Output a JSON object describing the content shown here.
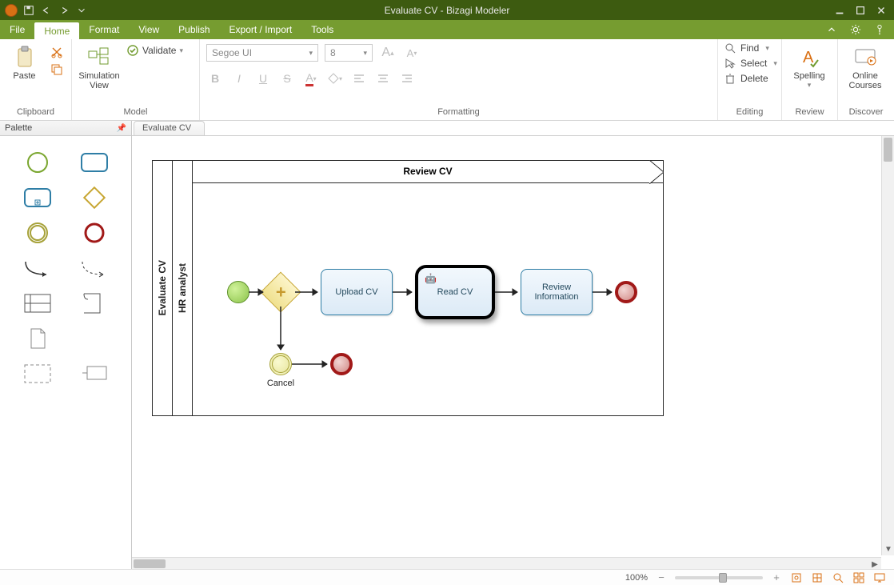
{
  "title": "Evaluate CV - Bizagi Modeler",
  "menu": {
    "file": "File",
    "home": "Home",
    "format": "Format",
    "view": "View",
    "publish": "Publish",
    "export": "Export / Import",
    "tools": "Tools"
  },
  "ribbon": {
    "clipboard": {
      "paste": "Paste",
      "caption": "Clipboard"
    },
    "model": {
      "sim1": "Simulation",
      "sim2": "View",
      "validate": "Validate",
      "caption": "Model"
    },
    "formatting": {
      "font": "Segoe UI",
      "size": "8",
      "caption": "Formatting"
    },
    "editing": {
      "find": "Find",
      "select": "Select",
      "delete": "Delete",
      "caption": "Editing"
    },
    "review": {
      "spelling": "Spelling",
      "caption": "Review"
    },
    "discover": {
      "courses1": "Online",
      "courses2": "Courses",
      "caption": "Discover"
    }
  },
  "palette": {
    "title": "Palette"
  },
  "tab": "Evaluate CV",
  "diagram": {
    "pool": "Evaluate CV",
    "lane": "HR analyst",
    "subprocess": "Review CV",
    "task_upload": "Upload CV",
    "task_read": "Read CV",
    "task_review": "Review Information",
    "cancel": "Cancel"
  },
  "status": {
    "zoom": "100%"
  }
}
